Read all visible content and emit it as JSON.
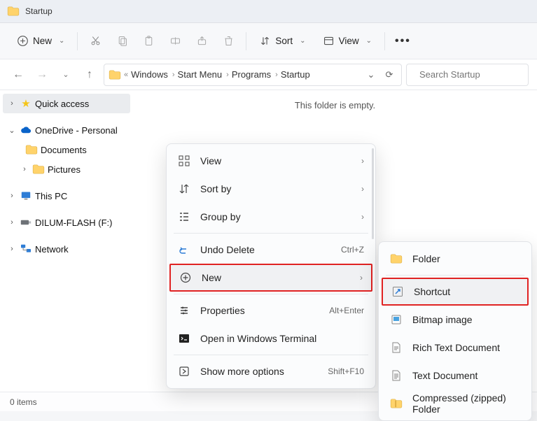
{
  "window": {
    "title": "Startup"
  },
  "toolbar": {
    "new": "New",
    "sort": "Sort",
    "view": "View"
  },
  "breadcrumb": {
    "items": [
      "Windows",
      "Start Menu",
      "Programs",
      "Startup"
    ]
  },
  "search": {
    "placeholder": "Search Startup"
  },
  "sidebar": {
    "quick": "Quick access",
    "onedrive": "OneDrive - Personal",
    "documents": "Documents",
    "pictures": "Pictures",
    "thispc": "This PC",
    "drive": "DILUM-FLASH (F:)",
    "network": "Network"
  },
  "content": {
    "empty": "This folder is empty."
  },
  "status": {
    "items": "0 items"
  },
  "ctx": {
    "view": "View",
    "sortby": "Sort by",
    "groupby": "Group by",
    "undo": "Undo Delete",
    "undo_hint": "Ctrl+Z",
    "new": "New",
    "properties": "Properties",
    "properties_hint": "Alt+Enter",
    "terminal": "Open in Windows Terminal",
    "more": "Show more options",
    "more_hint": "Shift+F10"
  },
  "submenu": {
    "folder": "Folder",
    "shortcut": "Shortcut",
    "bitmap": "Bitmap image",
    "rtf": "Rich Text Document",
    "txt": "Text Document",
    "zip": "Compressed (zipped) Folder"
  }
}
